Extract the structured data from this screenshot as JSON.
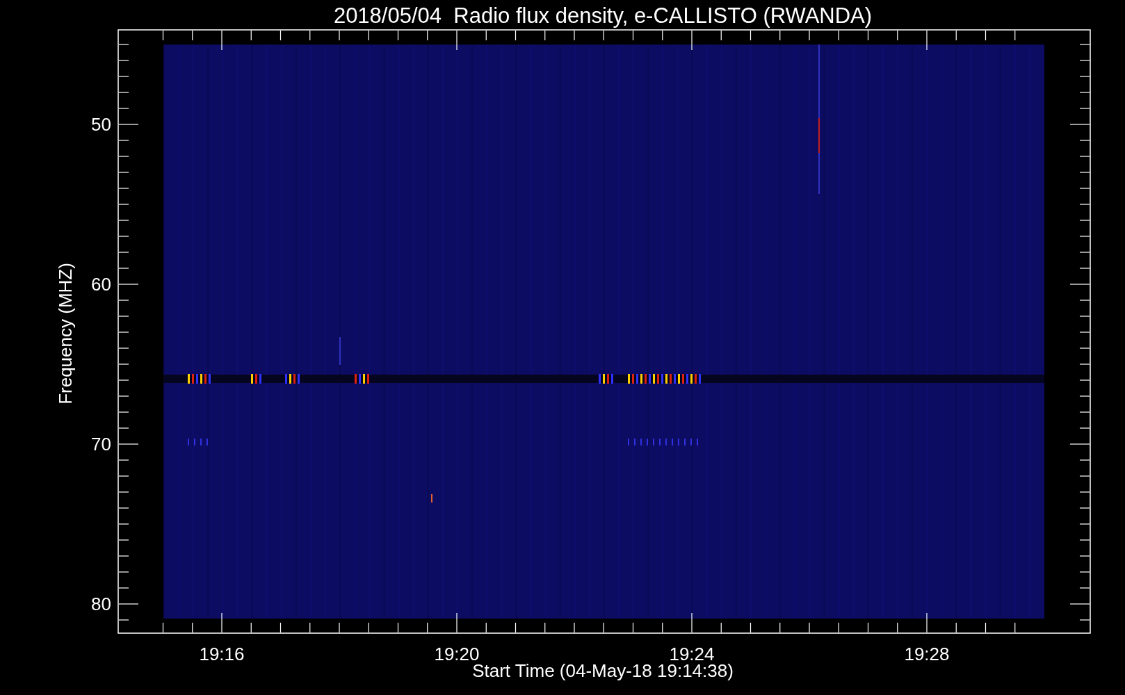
{
  "title": "2018/05/04  Radio flux density, e-CALLISTO (RWANDA)",
  "y_axis": {
    "label": "Frequency (MHZ)",
    "ticks": [
      "50",
      "60",
      "70",
      "80"
    ]
  },
  "x_axis": {
    "label": "Start Time (04-May-18 19:14:38)",
    "ticks": [
      "19:16",
      "19:20",
      "19:24",
      "19:28"
    ]
  }
}
